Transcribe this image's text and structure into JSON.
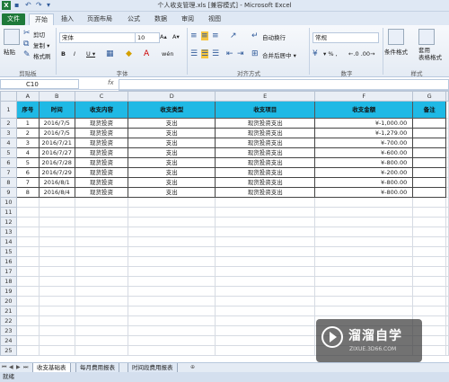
{
  "window": {
    "title": "个人收支管理.xls  [兼容模式]  -  Microsoft Excel",
    "app_icon": "X"
  },
  "tabs": [
    "文件",
    "开始",
    "插入",
    "页面布局",
    "公式",
    "数据",
    "审阅",
    "视图"
  ],
  "ribbon": {
    "clipboard": {
      "paste": "粘贴",
      "cut": "剪切",
      "copy": "复制 ▾",
      "format_painter": "格式刷",
      "group": "剪贴板"
    },
    "font": {
      "name": "宋体",
      "size": "10",
      "bold": "B",
      "italic": "I",
      "underline": "U ▾",
      "grow": "A▴",
      "shrink": "A▾",
      "group": "字体",
      "phonetic": "wén"
    },
    "alignment": {
      "wrap": "自动换行",
      "merge": "合并后居中 ▾",
      "group": "对齐方式"
    },
    "number": {
      "format": "常规",
      "currency": "▾ % ,",
      "decimals": "←.0 .00→",
      "group": "数字"
    },
    "styles": {
      "conditional": "条件格式",
      "table": "套用\n表格格式",
      "group": "样式"
    }
  },
  "formula_bar": {
    "cell_ref": "C10",
    "fx": "fx",
    "formula": ""
  },
  "grid": {
    "columns": [
      "A",
      "B",
      "C",
      "D",
      "E",
      "F",
      "G"
    ],
    "headers": [
      "序号",
      "时间",
      "收支内容",
      "收支类型",
      "收支项目",
      "收支金额",
      "备注"
    ],
    "rows": [
      [
        "1",
        "2016/7/5",
        "现货投资",
        "支出",
        "现货投资支出",
        "¥-1,000.00",
        ""
      ],
      [
        "2",
        "2016/7/5",
        "现货投资",
        "支出",
        "现货投资支出",
        "¥-1,279.00",
        ""
      ],
      [
        "3",
        "2016/7/21",
        "现货投资",
        "支出",
        "现货投资支出",
        "¥-700.00",
        ""
      ],
      [
        "4",
        "2016/7/27",
        "现货投资",
        "支出",
        "现货投资支出",
        "¥-600.00",
        ""
      ],
      [
        "5",
        "2016/7/28",
        "现货投资",
        "支出",
        "现货投资支出",
        "¥-800.00",
        ""
      ],
      [
        "6",
        "2016/7/29",
        "现货投资",
        "支出",
        "现货投资支出",
        "¥-200.00",
        ""
      ],
      [
        "7",
        "2016/8/1",
        "现货投资",
        "支出",
        "现货投资支出",
        "¥-800.00",
        ""
      ],
      [
        "8",
        "2016/8/4",
        "现货投资",
        "支出",
        "现货投资支出",
        "¥-800.00",
        ""
      ]
    ],
    "empty_row_labels": [
      "9",
      "10",
      "11",
      "12",
      "13",
      "14",
      "15",
      "16",
      "17",
      "18",
      "19",
      "20",
      "21",
      "22",
      "23",
      "24",
      "25"
    ],
    "header_row_label": "1",
    "data_row_labels": [
      "2",
      "3",
      "4",
      "5",
      "6",
      "7",
      "8",
      "9"
    ]
  },
  "sheet_tabs": [
    "收支基础表",
    "每月费用报表",
    "时间段费用报表"
  ],
  "status": {
    "text": "就绪"
  },
  "watermark": {
    "brand": "溜溜自学",
    "url": "ZIXUE.3D66.COM"
  },
  "colors": {
    "header_fill": "#1fb9e5",
    "file_tab": "#1f7a3a"
  }
}
